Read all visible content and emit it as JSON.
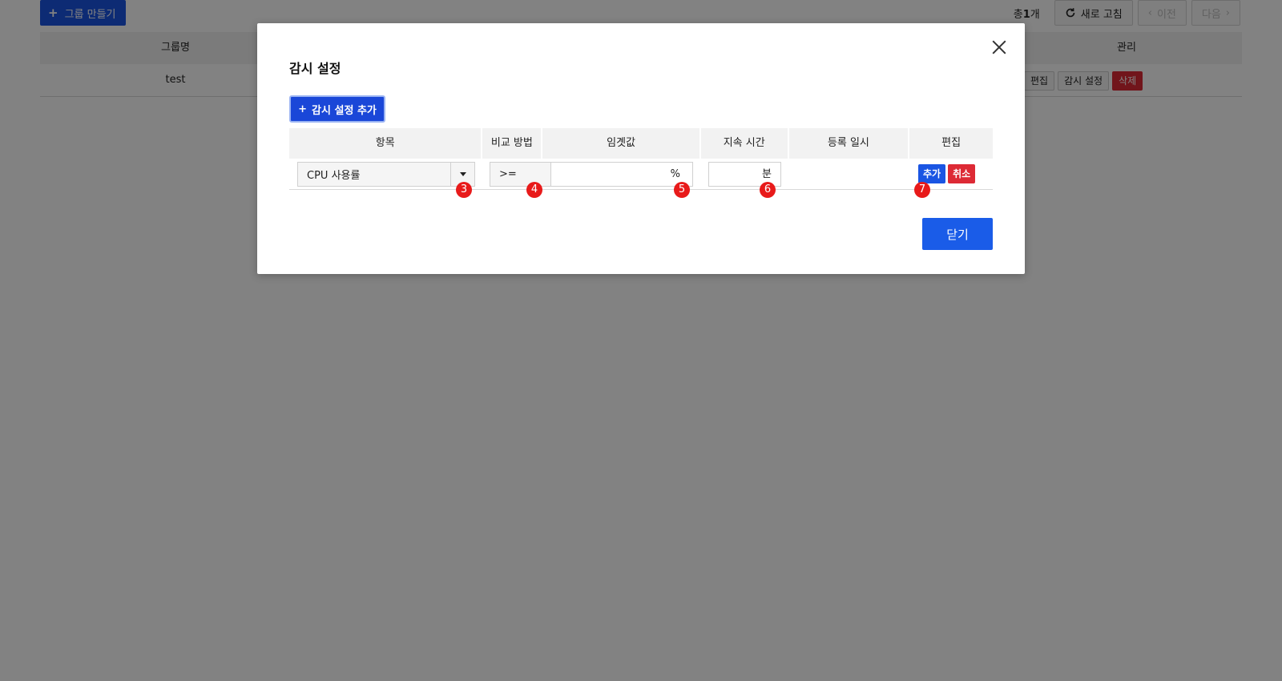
{
  "background": {
    "create_group_label": "그룹 만들기",
    "total_prefix": "총",
    "total_count": "1",
    "total_suffix": "개",
    "refresh_label": "새로 고침",
    "prev_label": "이전",
    "next_label": "다음",
    "table": {
      "headers": {
        "name": "그룹명",
        "manage": "관리"
      },
      "rows": [
        {
          "name": "test"
        }
      ],
      "row_actions": {
        "edit": "편집",
        "monitor": "감시 설정",
        "delete": "삭제"
      }
    }
  },
  "modal": {
    "title": "감시 설정",
    "add_setting_label": "감시 설정 추가",
    "columns": [
      "항목",
      "비교 방법",
      "임곗값",
      "지속 시간",
      "등록 일시",
      "편집"
    ],
    "new_row": {
      "item_value": "CPU 사용률",
      "compare_value": ">=",
      "threshold_value": "",
      "threshold_unit": "%",
      "duration_value": "",
      "duration_unit": "분",
      "registered_at": "",
      "add_label": "추가",
      "cancel_label": "취소"
    },
    "close_label": "닫기"
  },
  "markers": [
    "3",
    "4",
    "5",
    "6",
    "7"
  ],
  "colors": {
    "primary": "#1a55e3",
    "danger": "#dd2a35",
    "marker": "#e81a1a",
    "header_bg": "#f2f2f2"
  }
}
